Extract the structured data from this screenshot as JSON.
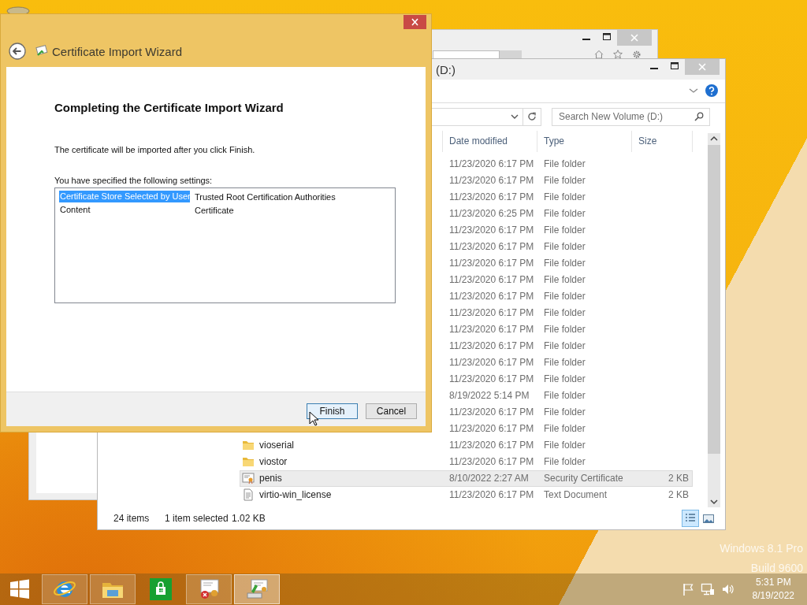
{
  "wizard": {
    "title": "Certificate Import Wizard",
    "heading": "Completing the Certificate Import Wizard",
    "message": "The certificate will be imported after you click Finish.",
    "settings_label": "You have specified the following settings:",
    "settings": [
      {
        "name": "Certificate Store Selected by User",
        "value": "Trusted Root Certification Authorities",
        "selected": true
      },
      {
        "name": "Content",
        "value": "Certificate",
        "selected": false
      }
    ],
    "buttons": [
      {
        "label": "Finish",
        "focused": true
      },
      {
        "label": "Cancel",
        "focused": false
      }
    ]
  },
  "explorer": {
    "title": "(D:)",
    "search": {
      "placeholder": "Search New Volume (D:)"
    },
    "columns": [
      "Date modified",
      "Type",
      "Size"
    ],
    "rows": [
      {
        "date": "11/23/2020 6:17 PM",
        "type": "File folder",
        "selected": false
      },
      {
        "date": "11/23/2020 6:17 PM",
        "type": "File folder",
        "selected": false
      },
      {
        "date": "11/23/2020 6:17 PM",
        "type": "File folder",
        "selected": false
      },
      {
        "date": "11/23/2020 6:25 PM",
        "type": "File folder",
        "selected": false
      },
      {
        "date": "11/23/2020 6:17 PM",
        "type": "File folder",
        "selected": false
      },
      {
        "date": "11/23/2020 6:17 PM",
        "type": "File folder",
        "selected": false
      },
      {
        "date": "11/23/2020 6:17 PM",
        "type": "File folder",
        "selected": false
      },
      {
        "date": "11/23/2020 6:17 PM",
        "type": "File folder",
        "selected": false
      },
      {
        "date": "11/23/2020 6:17 PM",
        "type": "File folder",
        "selected": false
      },
      {
        "date": "11/23/2020 6:17 PM",
        "type": "File folder",
        "selected": false
      },
      {
        "date": "11/23/2020 6:17 PM",
        "type": "File folder",
        "selected": false
      },
      {
        "date": "11/23/2020 6:17 PM",
        "type": "File folder",
        "selected": false
      },
      {
        "date": "11/23/2020 6:17 PM",
        "type": "File folder",
        "selected": false
      },
      {
        "date": "11/23/2020 6:17 PM",
        "type": "File folder",
        "selected": false
      },
      {
        "date": "8/19/2022 5:14 PM",
        "type": "File folder",
        "selected": false
      },
      {
        "date": "11/23/2020 6:17 PM",
        "type": "File folder",
        "selected": false
      },
      {
        "date": "11/23/2020 6:17 PM",
        "type": "File folder",
        "selected": false
      },
      {
        "name": "vioserial",
        "kind": "folder",
        "date": "11/23/2020 6:17 PM",
        "type": "File folder",
        "selected": false
      },
      {
        "name": "viostor",
        "kind": "folder",
        "date": "11/23/2020 6:17 PM",
        "type": "File folder",
        "selected": false
      },
      {
        "name": "penis",
        "kind": "certificate",
        "date": "8/10/2022 2:27 AM",
        "type": "Security Certificate",
        "size": "2 KB",
        "selected": true
      },
      {
        "name": "virtio-win_license",
        "kind": "text",
        "date": "11/23/2020 6:17 PM",
        "type": "Text Document",
        "size": "2 KB",
        "selected": false
      }
    ],
    "status": {
      "item_count": "24 items",
      "selection": "1 item selected",
      "selection_size": "1.02 KB"
    }
  },
  "desktop_text": [
    "Windows 8.1 Pro",
    "Build 9600"
  ],
  "taskbar": {
    "apps": [
      {
        "kind": "ie",
        "running": true,
        "selected": false
      },
      {
        "kind": "explorer",
        "running": true,
        "selected": false
      },
      {
        "kind": "store",
        "running": false,
        "selected": false
      },
      {
        "kind": "certmgr",
        "running": true,
        "selected": false
      },
      {
        "kind": "wizard",
        "running": true,
        "selected": true
      }
    ],
    "clock": {
      "time": "5:31 PM",
      "date": "8/19/2022"
    }
  }
}
